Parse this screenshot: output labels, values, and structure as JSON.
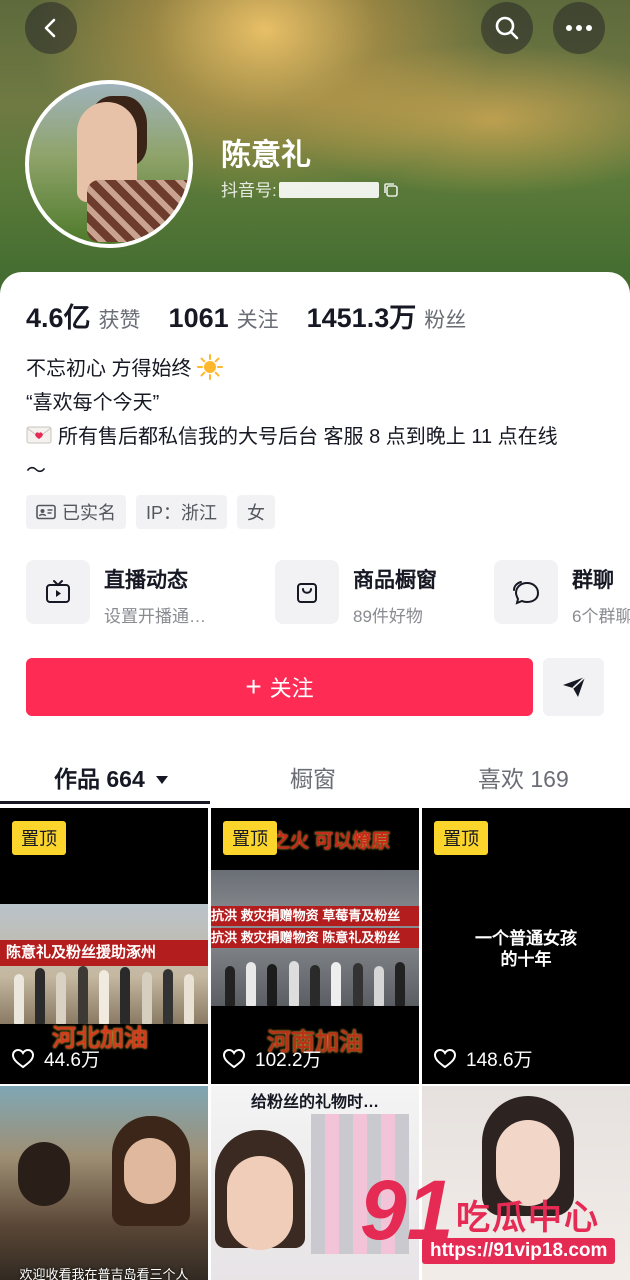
{
  "profile": {
    "name": "陈意礼",
    "douyin_id_label": "抖音号:"
  },
  "stats": [
    {
      "num": "4.6亿",
      "label": "获赞"
    },
    {
      "num": "1061",
      "label": "关注"
    },
    {
      "num": "1451.3万",
      "label": "粉丝"
    }
  ],
  "bio": {
    "line1": "不忘初心 方得始终",
    "line2": "“喜欢每个今天”",
    "line3": "所有售后都私信我的大号后台 客服 8 点到晚上 11 点在线",
    "line4": "～"
  },
  "tags": {
    "verified": "已实名",
    "ip": "IP：浙江",
    "gender": "女"
  },
  "entries": [
    {
      "title": "直播动态",
      "sub": "设置开播通…",
      "icon": "tv-icon"
    },
    {
      "title": "商品橱窗",
      "sub": "89件好物",
      "icon": "shopping-bag-icon"
    },
    {
      "title": "群聊",
      "sub": "6个群聊",
      "icon": "chat-bubble-icon"
    }
  ],
  "actions": {
    "follow": "关注"
  },
  "tabs": [
    {
      "label": "作品 664"
    },
    {
      "label": "橱窗"
    },
    {
      "label": "喜欢 169"
    }
  ],
  "videos": [
    {
      "pinned": "置顶",
      "likes": "44.6万",
      "banner": "陈意礼及粉丝援助涿州",
      "caption": "河北加油"
    },
    {
      "pinned": "置顶",
      "likes": "102.2万",
      "top_text": "之火 可以燎原",
      "banner1": "抗洪 救灾捐赠物资 草莓青及粉丝",
      "banner2": "抗洪 救灾捐赠物资 陈意礼及粉丝",
      "caption": "河南加油"
    },
    {
      "pinned": "置顶",
      "likes": "148.6万",
      "text1": "一个普通女孩",
      "text2": "的十年"
    },
    {
      "caption": "欢迎收看我在普吉岛看三个人"
    },
    {
      "caption": "给粉丝的礼物时…"
    },
    {}
  ],
  "watermark": {
    "num": "91",
    "cn": "吃瓜中心",
    "url": "https://91vip18.com"
  },
  "colors": {
    "accent": "#fe2c55",
    "pin": "#fbd52b",
    "watermark": "#e52a54"
  }
}
